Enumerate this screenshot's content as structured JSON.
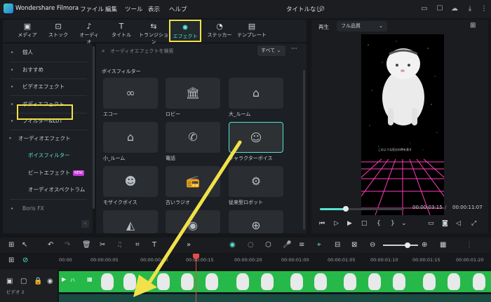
{
  "titlebar": {
    "app_name": "Wondershare Filmora",
    "menus": [
      "ファイル",
      "編集",
      "ツール",
      "表示",
      "ヘルプ"
    ],
    "project_title": "タイトルなし"
  },
  "tabs": [
    {
      "label": "メディア",
      "icon": "media-icon"
    },
    {
      "label": "ストック",
      "icon": "stock-icon"
    },
    {
      "label": "オーディオ",
      "icon": "audio-icon"
    },
    {
      "label": "タイトル",
      "icon": "title-icon"
    },
    {
      "label": "トランジション",
      "icon": "transition-icon"
    },
    {
      "label": "エフェクト",
      "icon": "effects-icon"
    },
    {
      "label": "ステッカー",
      "icon": "sticker-icon"
    },
    {
      "label": "テンプレート",
      "icon": "template-icon"
    }
  ],
  "sidebar": {
    "items": [
      "個人",
      "おすすめ",
      "ビデオエフェクト",
      "ボディエフェクト",
      "フィルター&LUT",
      "オーディオエフェクト"
    ],
    "sub_items": [
      "ボイスフィルター",
      "ビートエフェクト",
      "オーディオスペクトラム"
    ],
    "new_badge": "NEW",
    "last_item": "Boris FX"
  },
  "content": {
    "search_placeholder": "オーディオエフェクトを検索",
    "filter_label": "すべて",
    "section_title": "ボイスフィルター",
    "cards": [
      {
        "label": "エコー",
        "icon": "infinity-icon"
      },
      {
        "label": "ロビー",
        "icon": "bank-icon"
      },
      {
        "label": "大_ルーム",
        "icon": "house-large-icon"
      },
      {
        "label": "小_ルーム",
        "icon": "house-small-icon"
      },
      {
        "label": "電話",
        "icon": "phone-icon"
      },
      {
        "label": "キャラクターボイス",
        "icon": "character-face-icon"
      },
      {
        "label": "モザイクボイス",
        "icon": "mask-icon"
      },
      {
        "label": "古いラジオ",
        "icon": "radio-icon"
      },
      {
        "label": "従来型ロボット",
        "icon": "robot-icon"
      },
      {
        "label": "",
        "icon": "ai-icon"
      },
      {
        "label": "",
        "icon": "car-icon"
      },
      {
        "label": "",
        "icon": "cycle-icon"
      }
    ]
  },
  "preview": {
    "label": "再生",
    "quality": "フル品質",
    "video_caption": "このような気分の時を表す",
    "current_time": "00:00:03:15",
    "total_time": "00:00:11:07",
    "progress": 0.31
  },
  "timeline": {
    "ruler": [
      "00:00",
      "00:00:00:05",
      "00:00:00:10",
      "00:00:00:15",
      "00:00:00:20",
      "00:00:01:00",
      "00:00:01:05",
      "00:00:01:10",
      "00:00:01:15",
      "00:00:01:20"
    ],
    "track_name": "ビデオ 2",
    "clip_title": "ハ",
    "zoom": 0.7
  },
  "colors": {
    "accent": "#57e3cf",
    "highlight": "#f1e14a",
    "clip": "#26b94a",
    "playhead": "#e74b4b"
  }
}
